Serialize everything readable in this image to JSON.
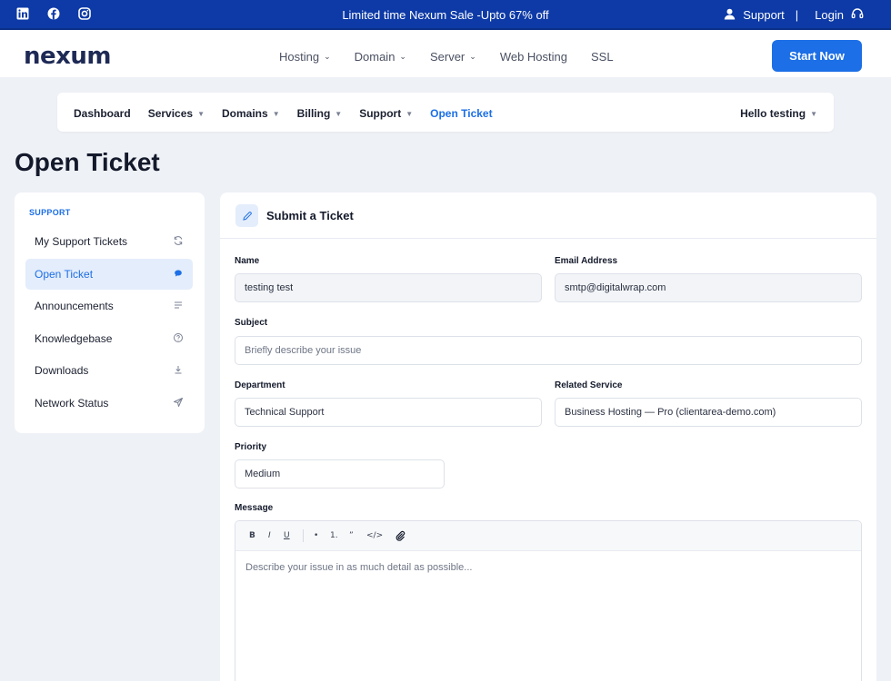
{
  "topbar": {
    "promo": "Limited time Nexum Sale -Upto 67% off",
    "support_label": "Support",
    "separator": "|",
    "login_label": "Login",
    "social_icons": [
      "linkedin-icon",
      "facebook-icon",
      "instagram-icon"
    ],
    "bg_color": "#0d3aa6"
  },
  "header": {
    "logo_text": "nexum",
    "nav": [
      {
        "label": "Hosting"
      },
      {
        "label": "Domain"
      },
      {
        "label": "Server"
      },
      {
        "label": "Web Hosting"
      },
      {
        "label": "SSL"
      }
    ],
    "cta_label": "Start Now",
    "accent_color": "#1c6fe6"
  },
  "subnav": {
    "items": [
      {
        "label": "Dashboard"
      },
      {
        "label": "Services"
      },
      {
        "label": "Domains"
      },
      {
        "label": "Billing"
      },
      {
        "label": "Support"
      },
      {
        "label": "Open Ticket"
      }
    ],
    "user_greeting": "Hello testing"
  },
  "page": {
    "title": "Open Ticket"
  },
  "sidebar": {
    "section_label": "SUPPORT",
    "items": [
      {
        "label": "My Support Tickets",
        "icon": "refresh-icon"
      },
      {
        "label": "Open Ticket",
        "icon": "chat-bubble-icon"
      },
      {
        "label": "Announcements",
        "icon": "list-icon"
      },
      {
        "label": "Knowledgebase",
        "icon": "help-circle-icon"
      },
      {
        "label": "Downloads",
        "icon": "download-icon"
      },
      {
        "label": "Network Status",
        "icon": "send-icon"
      }
    ]
  },
  "form": {
    "title": "Submit a Ticket",
    "name": {
      "label": "Name",
      "value": "testing test"
    },
    "email": {
      "label": "Email Address",
      "value": "smtp@digitalwrap.com"
    },
    "subject": {
      "label": "Subject",
      "placeholder": "Briefly describe your issue"
    },
    "department": {
      "label": "Department",
      "value": "Technical Support"
    },
    "related_service": {
      "label": "Related Service",
      "value": "Business Hosting — Pro (clientarea-demo.com)"
    },
    "priority": {
      "label": "Priority",
      "value": "Medium"
    },
    "message": {
      "label": "Message",
      "placeholder": "Describe your issue in as much detail as possible...",
      "toolbar": {
        "bold": "B",
        "italic": "I",
        "underline": "U",
        "bullet": "•",
        "numbered": "1.",
        "quote": "”",
        "code": "</>"
      }
    }
  }
}
